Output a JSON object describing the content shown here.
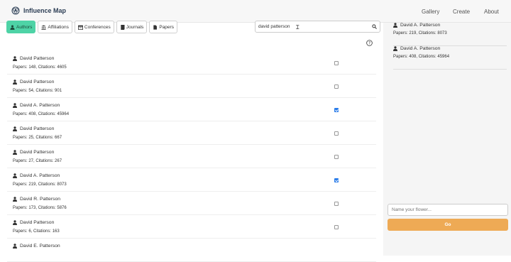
{
  "navbar": {
    "title": "Influence Map",
    "links": [
      "Gallery",
      "Create",
      "About"
    ]
  },
  "filters": {
    "buttons": [
      {
        "label": "Authors",
        "icon": "user-icon",
        "active": true
      },
      {
        "label": "Affiliations",
        "icon": "institution-icon",
        "active": false
      },
      {
        "label": "Conferences",
        "icon": "calendar-icon",
        "active": false
      },
      {
        "label": "Journals",
        "icon": "book-icon",
        "active": false
      },
      {
        "label": "Papers",
        "icon": "file-icon",
        "active": false
      }
    ]
  },
  "search": {
    "value": "david patterson",
    "placeholder": ""
  },
  "results": [
    {
      "name": "David Patterson",
      "stats": "Papers: 148, Citations: 4605",
      "checked": false
    },
    {
      "name": "David Patterson",
      "stats": "Papers: 54, Citations: 901",
      "checked": false
    },
    {
      "name": "David A. Patterson",
      "stats": "Papers: 408, Citations: 45964",
      "checked": true
    },
    {
      "name": "David Patterson",
      "stats": "Papers: 25, Citations: 667",
      "checked": false
    },
    {
      "name": "David Patterson",
      "stats": "Papers: 27, Citations: 267",
      "checked": false
    },
    {
      "name": "David A. Patterson",
      "stats": "Papers: 219, Citations: 8073",
      "checked": true
    },
    {
      "name": "David R. Patterson",
      "stats": "Papers: 173, Citations: 5876",
      "checked": false
    },
    {
      "name": "David Patterson",
      "stats": "Papers: 6, Citations: 163",
      "checked": false
    },
    {
      "name": "David E. Patterson",
      "stats": "",
      "checked": false
    }
  ],
  "selected": [
    {
      "name": "David A. Patterson",
      "stats": "Papers: 219, Citations: 8073"
    },
    {
      "name": "David A. Patterson",
      "stats": "Papers: 408, Citations: 45964"
    }
  ],
  "flower": {
    "placeholder": "Name your flower...",
    "go_label": "Go"
  },
  "colors": {
    "active_filter": "#4ed3a6",
    "go_button": "#eeaa55",
    "checkbox_checked": "#2b7de9"
  }
}
